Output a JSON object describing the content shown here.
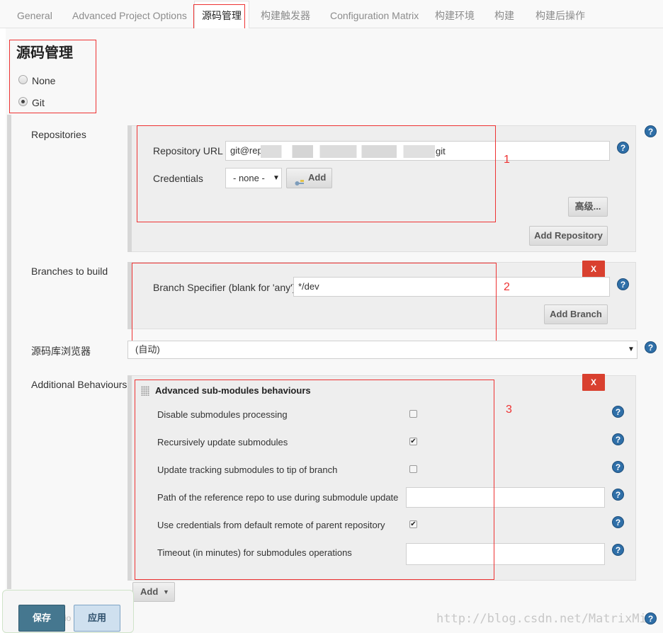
{
  "tabs": [
    {
      "label": "General"
    },
    {
      "label": "Advanced Project Options"
    },
    {
      "label": "源码管理"
    },
    {
      "label": "构建触发器"
    },
    {
      "label": "Configuration Matrix"
    },
    {
      "label": "构建环境"
    },
    {
      "label": "构建"
    },
    {
      "label": "构建后操作"
    }
  ],
  "active_tab": "源码管理",
  "scm": {
    "title": "源码管理",
    "options": [
      {
        "label": "None",
        "selected": false
      },
      {
        "label": "Git",
        "selected": true
      }
    ]
  },
  "repositories": {
    "label": "Repositories",
    "url_label": "Repository URL",
    "url_value_start": "git@rep",
    "url_value_end": "git",
    "credentials_label": "Credentials",
    "credentials_value": "- none -",
    "add_label": "Add",
    "advanced_label": "高级...",
    "add_repository_label": "Add Repository"
  },
  "branches": {
    "label": "Branches to build",
    "specifier_label": "Branch Specifier (blank for 'any')",
    "specifier_value": "*/dev",
    "add_branch_label": "Add Branch",
    "delete_label": "X"
  },
  "browser": {
    "label": "源码库浏览器",
    "value": "(自动)"
  },
  "behaviours": {
    "label": "Additional Behaviours",
    "delete_label": "X",
    "title": "Advanced sub-modules behaviours",
    "rows": [
      {
        "label": "Disable submodules processing",
        "kind": "checkbox",
        "checked": false
      },
      {
        "label": "Recursively update submodules",
        "kind": "checkbox",
        "checked": true
      },
      {
        "label": "Update tracking submodules to tip of branch",
        "kind": "checkbox",
        "checked": false
      },
      {
        "label": "Path of the reference repo to use during submodule update",
        "kind": "input",
        "value": ""
      },
      {
        "label": "Use credentials from default remote of parent repository",
        "kind": "checkbox",
        "checked": true
      },
      {
        "label": "Timeout (in minutes) for submodules operations",
        "kind": "input",
        "value": ""
      }
    ],
    "add_label": "Add"
  },
  "footer": {
    "save_label": "保存",
    "apply_label": "应用",
    "partial_text": "io"
  },
  "annotations": [
    "1",
    "2",
    "3"
  ],
  "watermark": "http://blog.csdn.net/MatrixMin",
  "icons": {
    "help": "help-icon",
    "key": "key-icon",
    "drag": "drag-handle-icon"
  },
  "colors": {
    "accent": "#2f6fa8",
    "danger": "#d9402f",
    "annotation": "#ee3333",
    "save": "#45778f"
  }
}
